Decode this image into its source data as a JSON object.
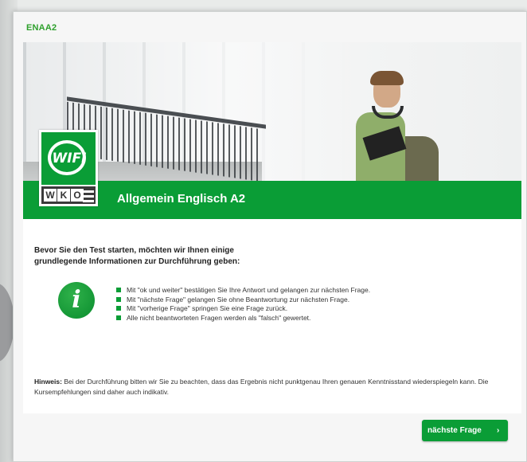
{
  "app": {
    "title": "ENAA2"
  },
  "banner": {
    "title": "Allgemein Englisch A2"
  },
  "logo": {
    "brand": "WIFI",
    "letters": [
      "W",
      "K",
      "O"
    ]
  },
  "intro": {
    "line1": "Bevor Sie den Test starten, möchten wir Ihnen einige",
    "line2": "grundlegende Informationen zur Durchführung geben:"
  },
  "info_icon": {
    "glyph": "i",
    "icon": "info-icon"
  },
  "instructions": [
    "Mit \"ok und weiter\" bestätigen Sie Ihre Antwort und gelangen zur nächsten Frage.",
    "Mit \"nächste Frage\" gelangen Sie ohne Beantwortung zur nächsten Frage.",
    "Mit \"vorherige Frage\" springen Sie eine Frage zurück.",
    "Alle nicht beantworteten Fragen werden als \"falsch\" gewertet."
  ],
  "note": {
    "label": "Hinweis:",
    "text": " Bei der Durchführung bitten wir Sie zu beachten, dass das Ergebnis nicht punktgenau Ihren genauen Kenntnisstand wiederspiegeln kann. Die Kursempfehlungen sind daher auch indikativ."
  },
  "next_button": {
    "label": "nächste Frage",
    "arrow": "›"
  },
  "colors": {
    "brand_green": "#0a9d36",
    "title_green": "#2ea02c"
  }
}
